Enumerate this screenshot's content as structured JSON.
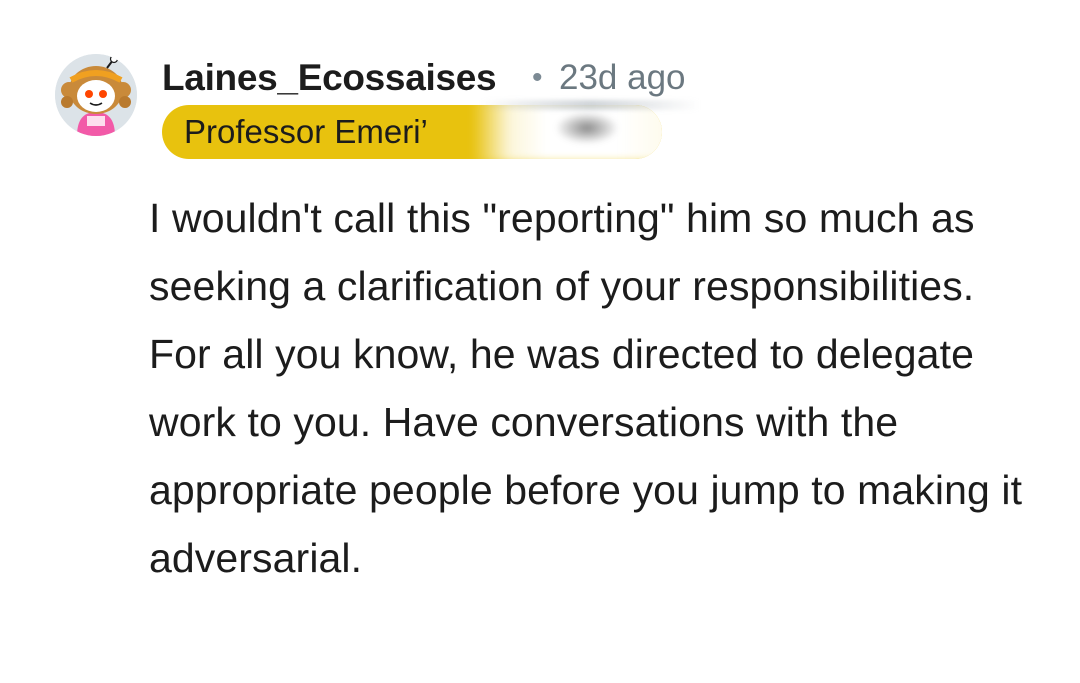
{
  "comment": {
    "author": "Laines_Ecossaises",
    "separator": "•",
    "time_ago": "23d ago",
    "flair": "Professor Emeri’",
    "body": "I wouldn't call this \"reporting\" him so much as seeking a clarification of your responsibilities. For all you know, he was directed to delegate work to you. Have conversations with the appropriate people before you jump to making it adversarial."
  },
  "colors": {
    "flair_background": "#e8c20e",
    "author_text": "#1c1c1c",
    "meta_text": "#6b7880",
    "background": "#ffffff"
  },
  "icons": {
    "avatar": "snoo-avatar-icon"
  }
}
